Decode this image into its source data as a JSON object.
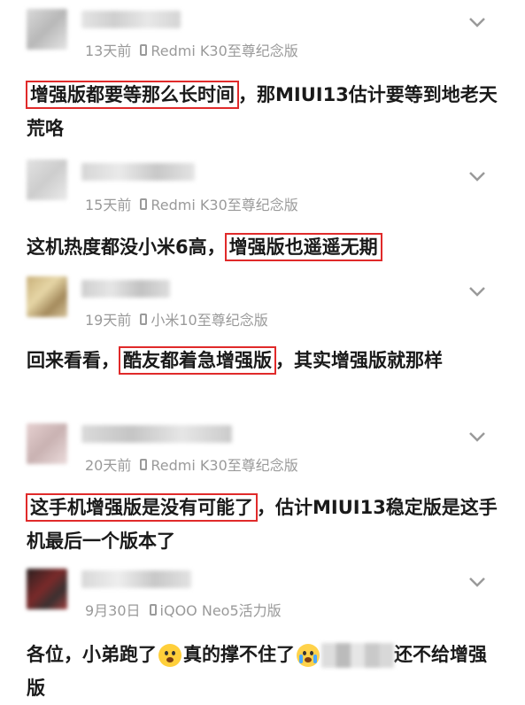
{
  "comments": [
    {
      "time": "13天前",
      "device": "Redmi K30至尊纪念版",
      "segments": [
        {
          "text": "增强版都要等那么长时间",
          "hl": true
        },
        {
          "text": "，那MIUI13估计要等到地老天荒咯",
          "hl": false
        }
      ]
    },
    {
      "time": "15天前",
      "device": "Redmi K30至尊纪念版",
      "segments": [
        {
          "text": "这机热度都没小米6高，",
          "hl": false
        },
        {
          "text": "增强版也遥遥无期",
          "hl": true
        }
      ]
    },
    {
      "time": "19天前",
      "device": "小米10至尊纪念版",
      "segments": [
        {
          "text": "回来看看，",
          "hl": false
        },
        {
          "text": "酷友都着急增强版",
          "hl": true
        },
        {
          "text": "，其实增强版就那样",
          "hl": false
        }
      ]
    },
    {
      "time": "20天前",
      "device": "Redmi K30至尊纪念版",
      "segments": [
        {
          "text": "这手机增强版是没有可能了",
          "hl": true
        },
        {
          "text": "，估计MIUI13稳定版是这手机最后一个版本了",
          "hl": false
        }
      ]
    },
    {
      "time": "9月30日",
      "device": "iQOO Neo5活力版",
      "segments": [
        {
          "text": "各位，小弟跑了",
          "hl": false
        },
        {
          "text": "真的撑不住了",
          "hl": false
        },
        {
          "text": "还不给增强版",
          "hl": false
        }
      ]
    }
  ],
  "icons": {
    "expand": "chevron-down-icon",
    "device": "phone-icon"
  },
  "colors": {
    "highlight": "#e02a2a",
    "meta": "#9a9a9a",
    "text": "#1a1a1a"
  }
}
